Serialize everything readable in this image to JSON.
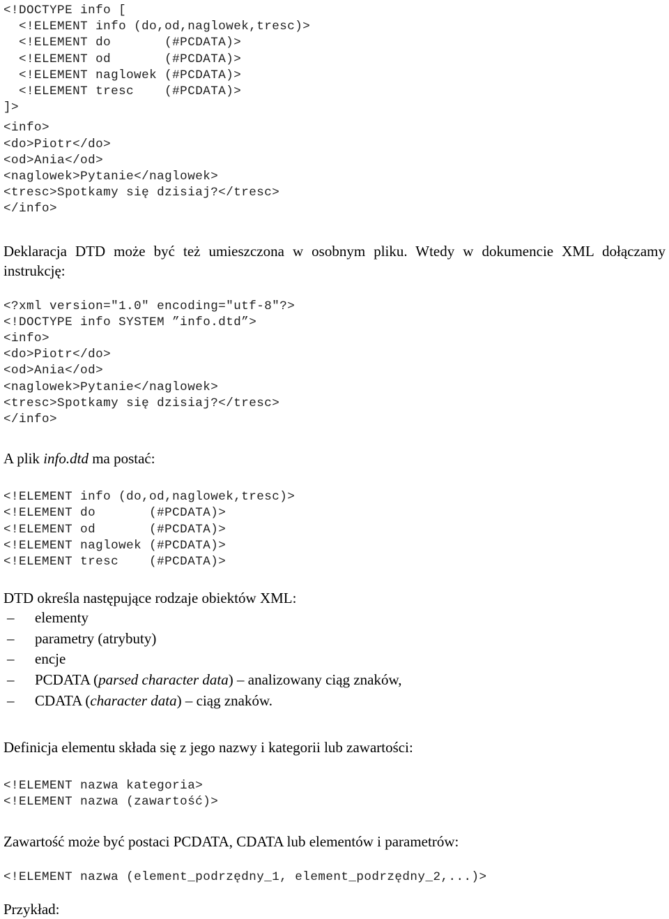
{
  "document": {
    "language": "pl",
    "background_color": "#ffffff",
    "text_color": "#000000",
    "code_color": "#1d1d1d"
  },
  "blocks": {
    "dtd_internal_code": "<!DOCTYPE info [\n  <!ELEMENT info (do,od,naglowek,tresc)>\n  <!ELEMENT do       (#PCDATA)>\n  <!ELEMENT od       (#PCDATA)>\n  <!ELEMENT naglowek (#PCDATA)>\n  <!ELEMENT tresc    (#PCDATA)>\n]>",
    "xml_body_code": "<info>\n<do>Piotr</do>\n<od>Ania</od>\n<naglowek>Pytanie</naglowek>\n<tresc>Spotkamy się dzisiaj?</tresc>\n</info>",
    "para_external_dtd": "Deklaracja DTD może być też umieszczona w osobnym pliku. Wtedy w dokumencie XML dołączamy instrukcję:",
    "xml_with_doctype": {
      "line_xml_decl": "<?xml version=\"1.0\" encoding=\"utf-8\"?>",
      "line_doctype_bold": "<!DOCTYPE info SYSTEM ”info.dtd”>",
      "rest": "<info>\n<do>Piotr</do>\n<od>Ania</od>\n<naglowek>Pytanie</naglowek>\n<tresc>Spotkamy się dzisiaj?</tresc>\n</info>"
    },
    "para_infodtd": {
      "before": "A plik ",
      "italic": "info.dtd",
      "after": " ma postać:"
    },
    "dtd_file_code": "<!ELEMENT info (do,od,naglowek,tresc)>\n<!ELEMENT do       (#PCDATA)>\n<!ELEMENT od       (#PCDATA)>\n<!ELEMENT naglowek (#PCDATA)>\n<!ELEMENT tresc    (#PCDATA)>",
    "para_dtd_objects": "DTD określa następujące rodzaje obiektów XML:",
    "object_list": {
      "marker": "–",
      "items": [
        {
          "before": "elementy",
          "italic": "",
          "after": ""
        },
        {
          "before": "parametry (atrybuty)",
          "italic": "",
          "after": ""
        },
        {
          "before": "encje",
          "italic": "",
          "after": ""
        },
        {
          "before": "PCDATA (",
          "italic": "parsed character data",
          "after": ") – analizowany ciąg znaków,"
        },
        {
          "before": "CDATA (",
          "italic": "character data",
          "after": ") – ciąg znaków."
        }
      ]
    },
    "para_definicja": "Definicja elementu składa się z jego nazwy i kategorii lub zawartości:",
    "element_syntax_code": "<!ELEMENT nazwa kategoria>\n<!ELEMENT nazwa (zawartość)>",
    "para_zawartosc": "Zawartość może być postaci PCDATA, CDATA lub elementów i parametrów:",
    "element_children_code": "<!ELEMENT nazwa (element_podrzędny_1, element_podrzędny_2,...)>",
    "para_przyklad": "Przykład:"
  }
}
